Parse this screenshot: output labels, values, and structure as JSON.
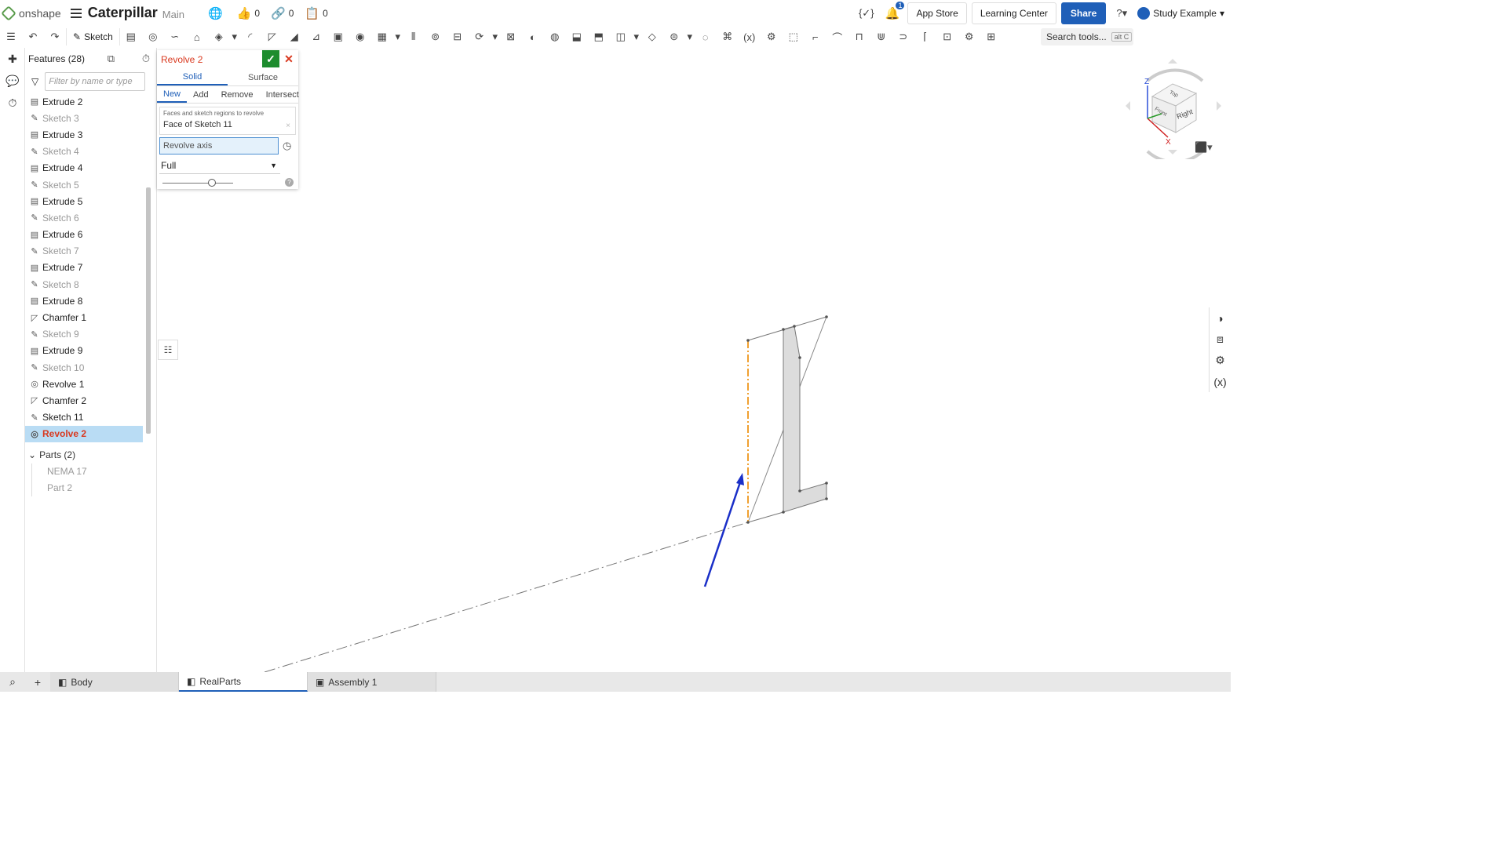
{
  "header": {
    "brand": "onshape",
    "doc_title": "Caterpillar",
    "branch": "Main",
    "likes": "0",
    "links": "0",
    "copies": "0",
    "notifications": "1",
    "app_store": "App Store",
    "learning_center": "Learning Center",
    "share": "Share",
    "user": "Study Example"
  },
  "toolbar": {
    "sketch_label": "Sketch",
    "search_label": "Search tools...",
    "search_kbd": "alt C"
  },
  "features": {
    "title": "Features (28)",
    "filter_placeholder": "Filter by name or type",
    "items": [
      {
        "label": "Extrude 2",
        "type": "extrude"
      },
      {
        "label": "Sketch 3",
        "type": "sketch"
      },
      {
        "label": "Extrude 3",
        "type": "extrude"
      },
      {
        "label": "Sketch 4",
        "type": "sketch"
      },
      {
        "label": "Extrude 4",
        "type": "extrude"
      },
      {
        "label": "Sketch 5",
        "type": "sketch"
      },
      {
        "label": "Extrude 5",
        "type": "extrude"
      },
      {
        "label": "Sketch 6",
        "type": "sketch"
      },
      {
        "label": "Extrude 6",
        "type": "extrude"
      },
      {
        "label": "Sketch 7",
        "type": "sketch"
      },
      {
        "label": "Extrude 7",
        "type": "extrude"
      },
      {
        "label": "Sketch 8",
        "type": "sketch"
      },
      {
        "label": "Extrude 8",
        "type": "extrude"
      },
      {
        "label": "Chamfer 1",
        "type": "chamfer"
      },
      {
        "label": "Sketch 9",
        "type": "sketch"
      },
      {
        "label": "Extrude 9",
        "type": "extrude"
      },
      {
        "label": "Sketch 10",
        "type": "sketch"
      },
      {
        "label": "Revolve 1",
        "type": "revolve"
      },
      {
        "label": "Chamfer 2",
        "type": "chamfer"
      },
      {
        "label": "Sketch 11",
        "type": "sketch-active"
      },
      {
        "label": "Revolve 2",
        "type": "revolve-selected"
      }
    ],
    "parts_title": "Parts (2)",
    "parts": [
      "NEMA 17",
      "Part 2"
    ]
  },
  "dialog": {
    "title": "Revolve 2",
    "tab_solid": "Solid",
    "tab_surface": "Surface",
    "op_new": "New",
    "op_add": "Add",
    "op_remove": "Remove",
    "op_intersect": "Intersect",
    "faces_caption": "Faces and sketch regions to revolve",
    "faces_value": "Face of Sketch 11",
    "axis_placeholder": "Revolve axis",
    "revolve_type": "Full"
  },
  "view_cube": {
    "axis_z": "Z",
    "axis_x": "X",
    "face_top": "Top",
    "face_front": "Front",
    "face_right": "Right"
  },
  "bottom_tabs": [
    {
      "label": "Body",
      "active": false
    },
    {
      "label": "RealParts",
      "active": true
    },
    {
      "label": "Assembly 1",
      "active": false
    }
  ],
  "colors": {
    "accent": "#1f5fb8",
    "selected_feature": "#d9381e",
    "axis_highlight": "#f0a030",
    "arrow": "#1a2fc8"
  }
}
